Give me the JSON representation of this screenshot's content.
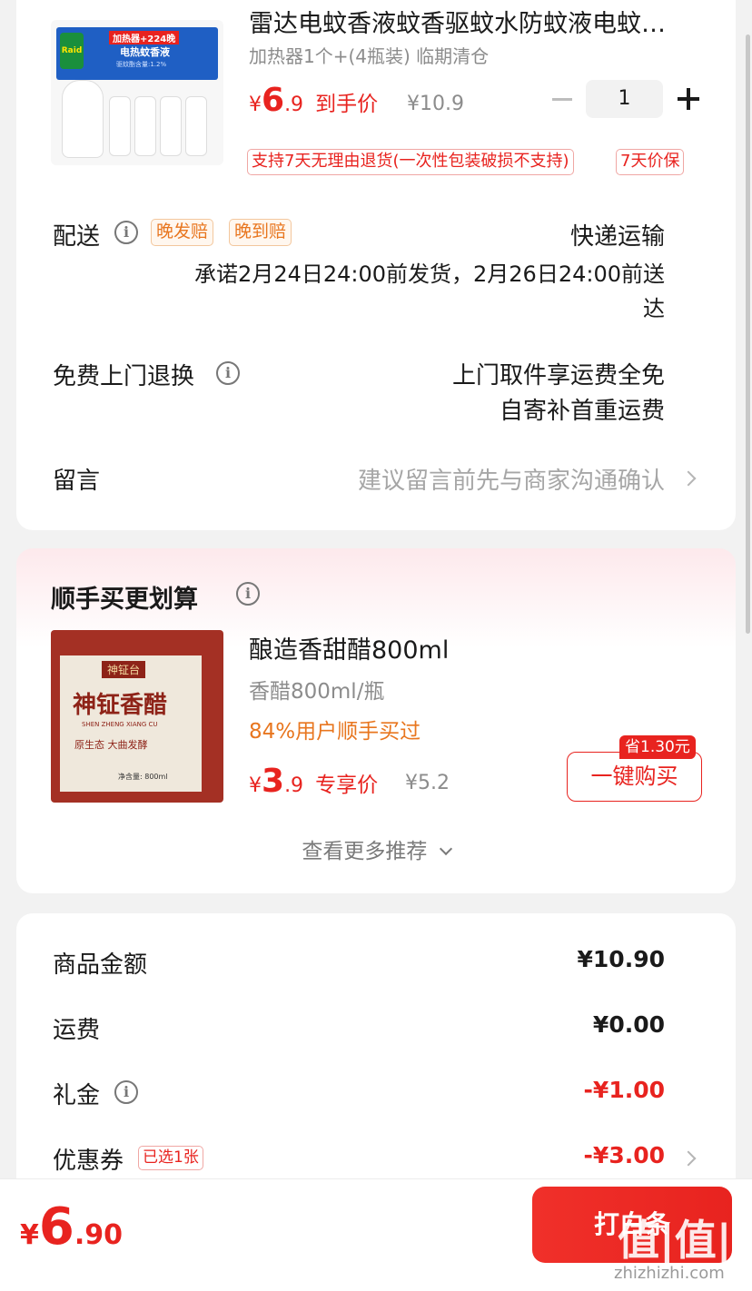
{
  "product": {
    "title": "雷达电蚊香液蚊香驱蚊水防蚊液电蚊…",
    "spec": "加热器1个+(4瓶装) 临期清仓",
    "price_symbol": "¥",
    "price_int": "6",
    "price_dec": ".9",
    "price_label": "到手价",
    "original_price": "¥10.9",
    "quantity": "1",
    "image_banner": "加热器+224晚",
    "image_sub": "电热蚊香液",
    "image_sub2": "驱蚊酯含量:1.2%",
    "image_brand": "Raid",
    "tags": [
      "支持7天无理由退货(一次性包装破损不支持)",
      "7天价保"
    ]
  },
  "delivery": {
    "label": "配送",
    "badges": [
      "晚发赔",
      "晚到赔"
    ],
    "method": "快递运输",
    "promise_line1": "承诺2月24日24:00前发货，2月26日24:00前送",
    "promise_line2": "达"
  },
  "return_service": {
    "label": "免费上门退换",
    "line1": "上门取件享运费全免",
    "line2": "自寄补首重运费"
  },
  "message": {
    "label": "留言",
    "placeholder": "建议留言前先与商家沟通确认"
  },
  "recommend": {
    "title": "顺手买更划算",
    "item": {
      "name": "酿造香甜醋800ml",
      "spec": "香醋800ml/瓶",
      "stat": "84%用户顺手买过",
      "price_symbol": "¥",
      "price_int": "3",
      "price_dec": ".9",
      "price_label": "专享价",
      "original_price": "¥5.2",
      "save_badge": "省1.30元",
      "buy_button": "一键购买",
      "image_brand": "神钲台",
      "image_name": "神钲香醋",
      "image_pinyin": "SHEN ZHENG XIANG CU",
      "image_slogan": "原生态 大曲发酵",
      "image_volume": "净含量: 800ml"
    },
    "more": "查看更多推荐"
  },
  "summary": {
    "rows": [
      {
        "label": "商品金额",
        "value": "¥10.90"
      },
      {
        "label": "运费",
        "value": "¥0.00"
      },
      {
        "label": "礼金",
        "value": "-¥1.00"
      },
      {
        "label": "优惠券",
        "value": "-¥3.00",
        "badge": "已选1张"
      }
    ]
  },
  "footer": {
    "total_symbol": "¥",
    "total_int": "6",
    "total_dec": ".90",
    "pay_button": "打白条"
  },
  "watermark": {
    "logo": "值|值|值",
    "site": "zhizhizhi.com"
  },
  "colors": {
    "accent": "#e8231f",
    "orange": "#e8761f",
    "background": "#f2f2f2"
  }
}
